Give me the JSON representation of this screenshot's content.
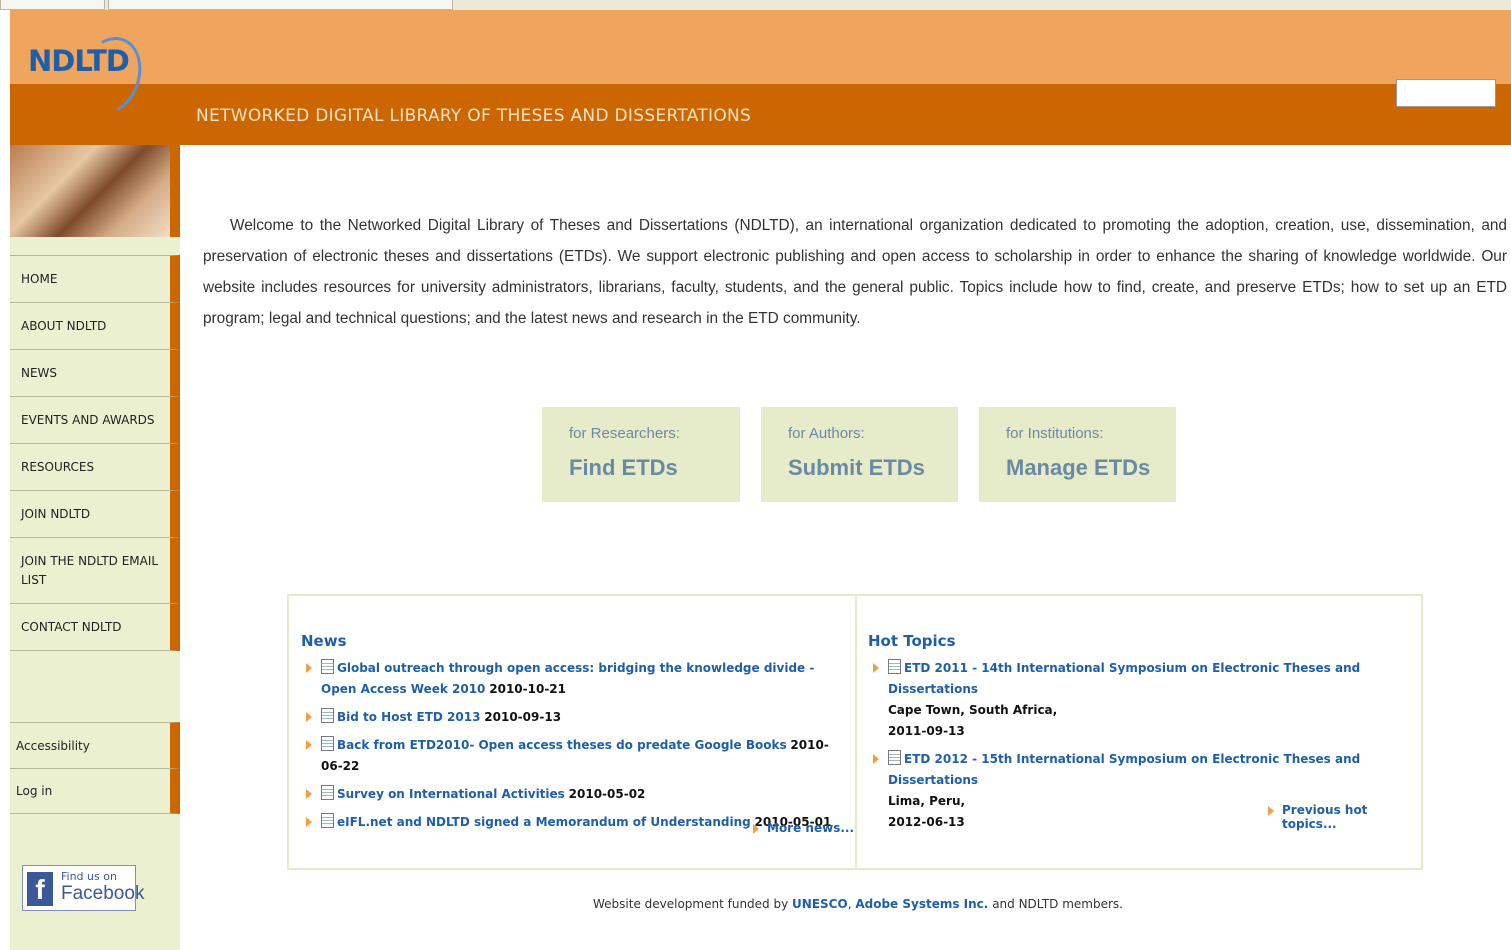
{
  "header": {
    "logo_text": "NDLTD",
    "site_title": "NETWORKED DIGITAL LIBRARY OF THESES AND DISSERTATIONS",
    "search_value": ""
  },
  "sidebar": {
    "items": [
      {
        "label": "HOME"
      },
      {
        "label": "ABOUT NDLTD"
      },
      {
        "label": "NEWS"
      },
      {
        "label": "EVENTS AND AWARDS"
      },
      {
        "label": "RESOURCES"
      },
      {
        "label": "JOIN NDLTD"
      },
      {
        "label": "JOIN THE NDLTD EMAIL LIST"
      },
      {
        "label": "CONTACT NDLTD"
      }
    ],
    "bottom_items": [
      {
        "label": "Accessibility"
      },
      {
        "label": "Log in"
      }
    ],
    "facebook": {
      "line1": "Find us on",
      "line2": "Facebook"
    }
  },
  "main": {
    "intro": "Welcome to the Networked Digital Library of Theses and Dissertations (NDLTD), an international organization dedicated to promoting the adoption, creation, use, dissemination, and preservation of electronic theses and dissertations (ETDs). We support electronic publishing and open access to scholarship in order to enhance the sharing of knowledge worldwide. Our website includes resources for university administrators, librarians, faculty, students, and the general public. Topics include how to find, create, and preserve ETDs; how to set up an ETD program; legal and technical questions; and the latest news and research in the ETD community.",
    "cta": [
      {
        "sub": "for Researchers:",
        "main": "Find ETDs"
      },
      {
        "sub": "for Authors:",
        "main": "Submit ETDs"
      },
      {
        "sub": "for Institutions:",
        "main": "Manage ETDs"
      }
    ],
    "news": {
      "heading": "News",
      "items": [
        {
          "title": "Global outreach through open access: bridging the knowledge divide - Open Access Week 2010",
          "date": "2010-10-21"
        },
        {
          "title": "Bid to Host ETD 2013",
          "date": "2010-09-13"
        },
        {
          "title": "Back from ETD2010- Open access theses do predate Google Books",
          "date": "2010-06-22"
        },
        {
          "title": "Survey on International Activities",
          "date": "2010-05-02"
        },
        {
          "title": "eIFL.net and NDLTD signed a Memorandum of Understanding",
          "date": "2010-05-01"
        }
      ],
      "more": "More news..."
    },
    "hot_topics": {
      "heading": "Hot Topics",
      "items": [
        {
          "title": "ETD 2011 - 14th International Symposium on Electronic Theses and Dissertations",
          "location": "Cape Town, South Africa,",
          "date": "2011-09-13"
        },
        {
          "title": "ETD 2012 - 15th International Symposium on Electronic Theses and Dissertations",
          "location": "Lima, Peru,",
          "date": "2012-06-13"
        }
      ],
      "more": "Previous hot topics..."
    }
  },
  "footer": {
    "prefix": "Website development funded by",
    "link1": "UNESCO",
    "sep": ",",
    "link2": "Adobe Systems Inc.",
    "suffix": "and NDLTD members."
  },
  "colors": {
    "header_light": "#f0a55e",
    "header_dark": "#cc6600",
    "sidebar_bg": "#eaf0d0",
    "link": "#1f5fa8"
  }
}
